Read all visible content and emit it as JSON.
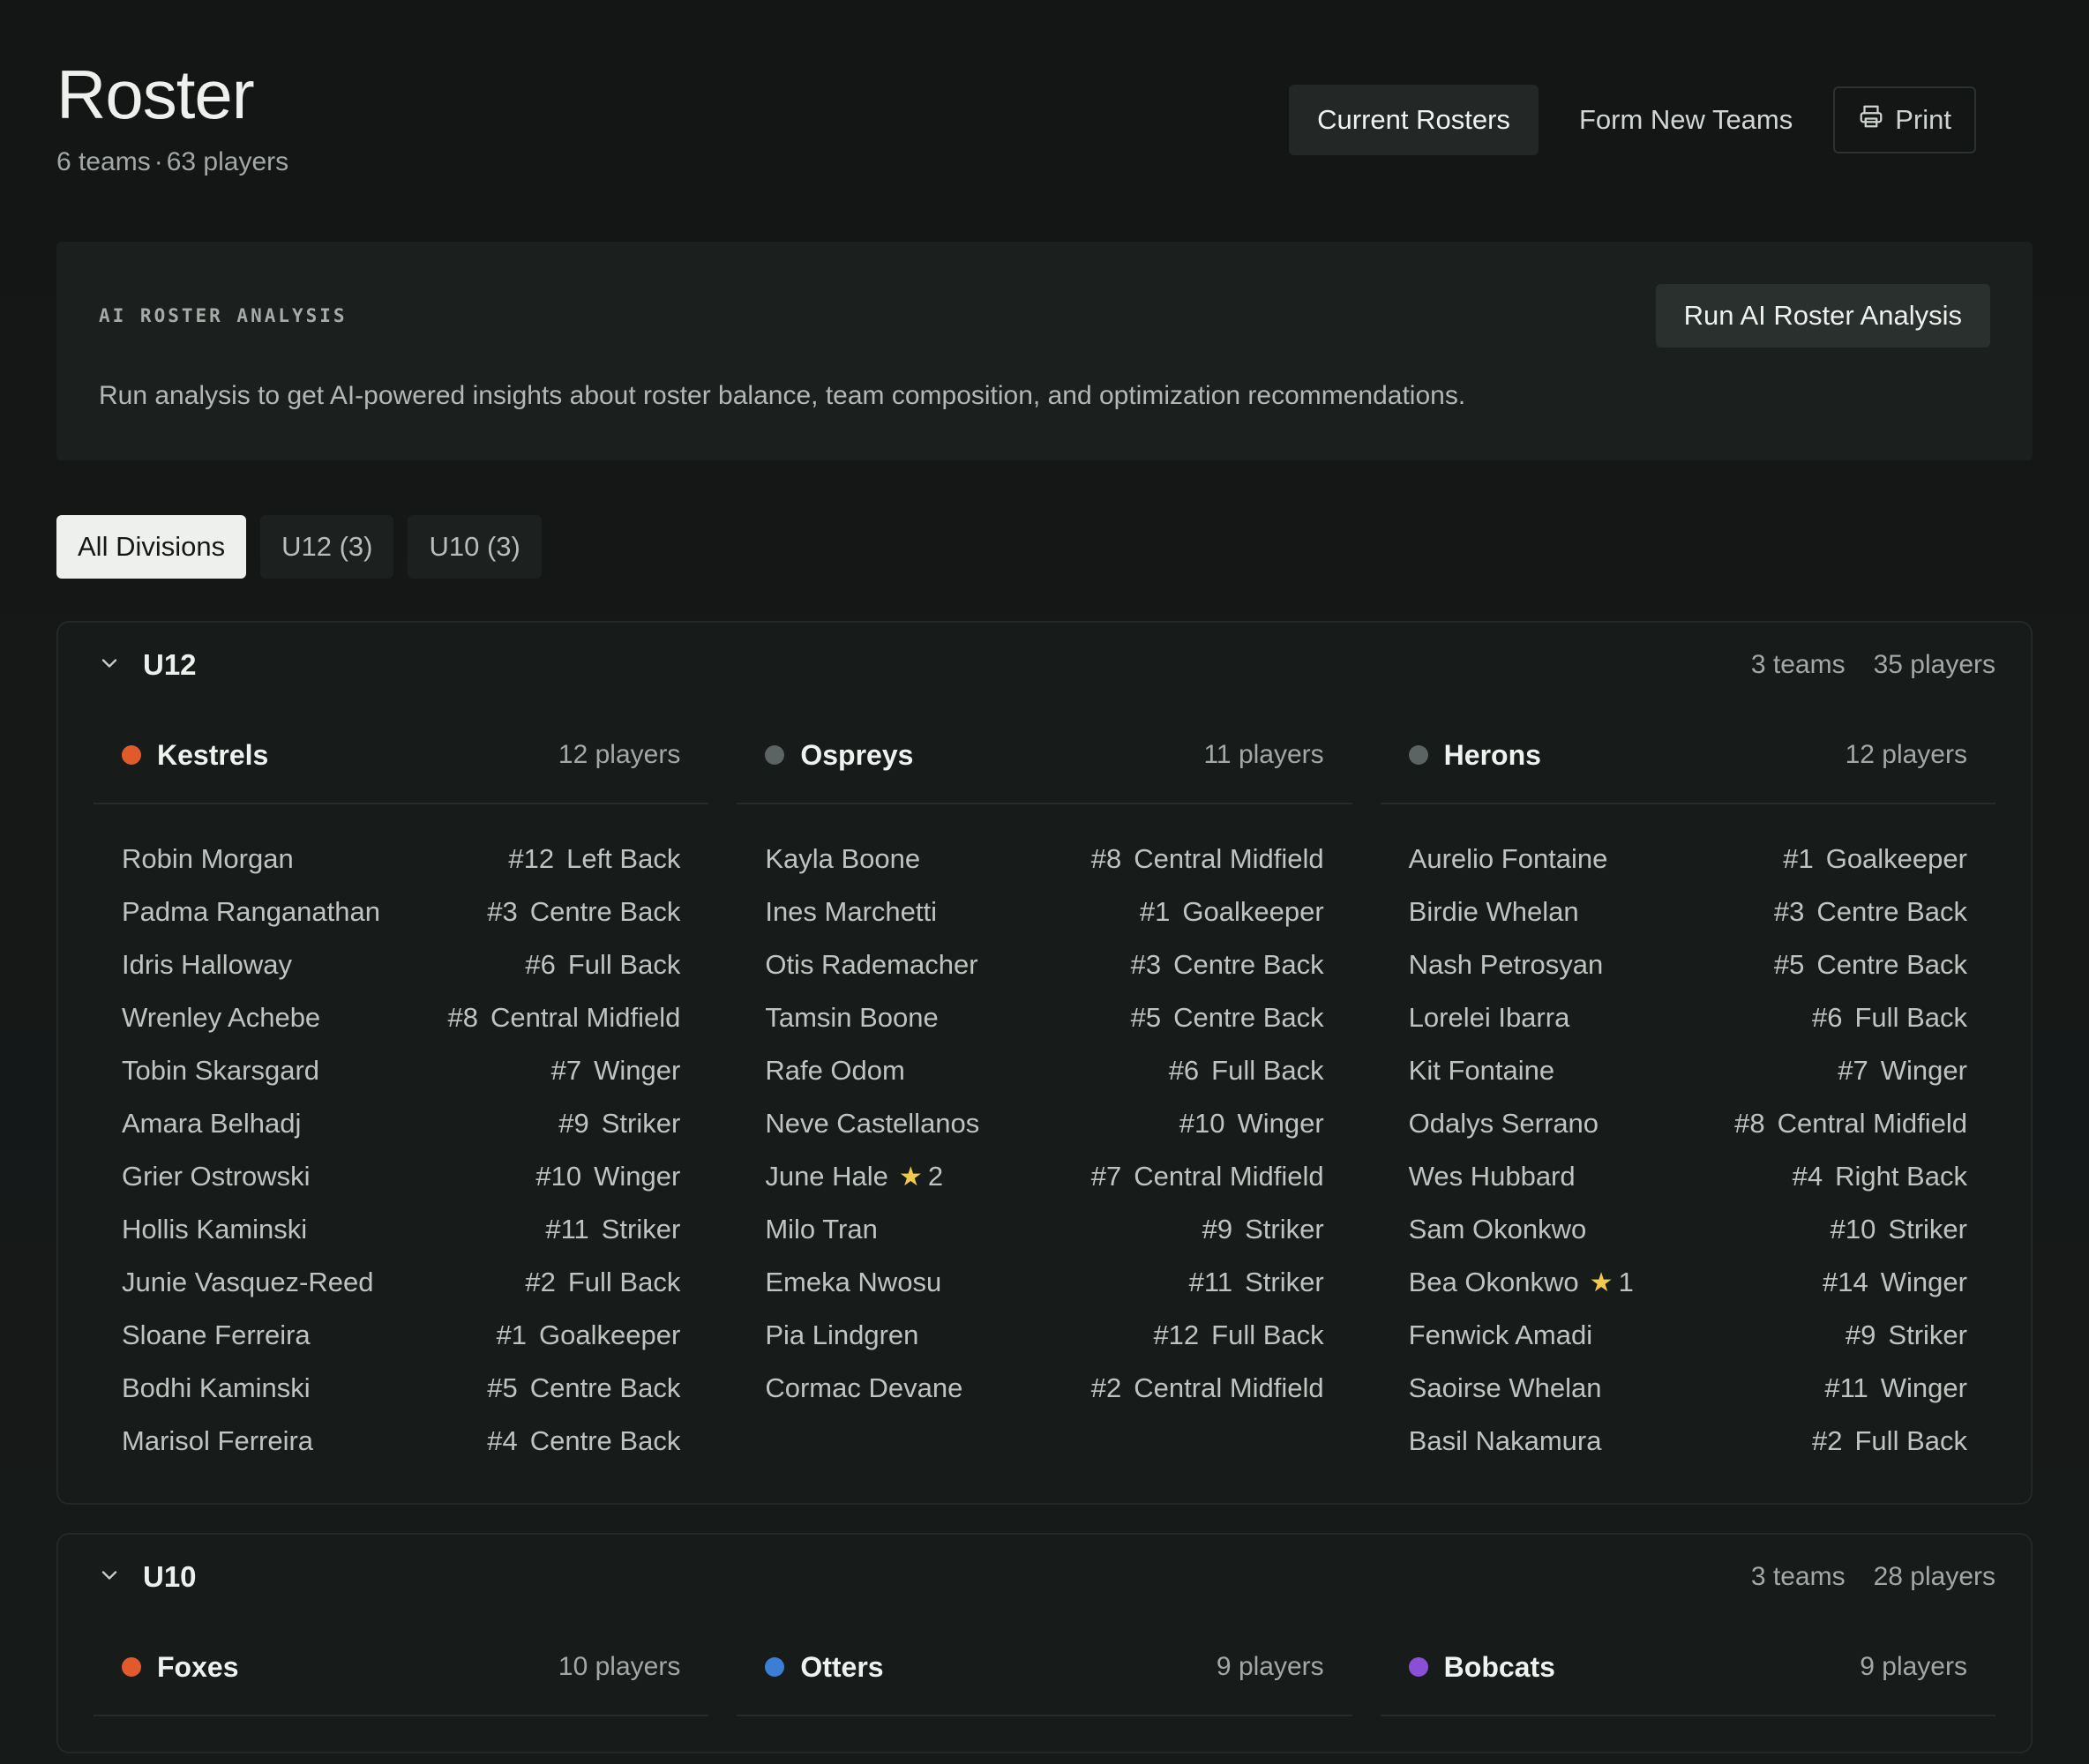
{
  "header": {
    "title": "Roster",
    "teams_count": "6 teams",
    "players_count": "63 players",
    "separator": "·",
    "buttons": {
      "current_rosters": "Current Rosters",
      "form_new_teams": "Form New Teams",
      "print": "Print"
    },
    "icons": {
      "print": "printer-icon"
    }
  },
  "ai_panel": {
    "label": "AI ROSTER ANALYSIS",
    "run_button": "Run AI Roster Analysis",
    "description": "Run analysis to get AI-powered insights about roster balance, team composition, and optimization recommendations."
  },
  "filters": [
    {
      "label": "All Divisions",
      "active": true
    },
    {
      "label": "U12 (3)",
      "active": false
    },
    {
      "label": "U10 (3)",
      "active": false
    }
  ],
  "divisions": [
    {
      "name": "U12",
      "teams_label": "3 teams",
      "players_label": "35 players",
      "teams": [
        {
          "name": "Kestrels",
          "color": "#e05a2b",
          "count": "12 players",
          "players": [
            {
              "name": "Robin Morgan",
              "number": "#12",
              "position": "Left Back"
            },
            {
              "name": "Padma Ranganathan",
              "number": "#3",
              "position": "Centre Back"
            },
            {
              "name": "Idris Halloway",
              "number": "#6",
              "position": "Full Back"
            },
            {
              "name": "Wrenley Achebe",
              "number": "#8",
              "position": "Central Midfield"
            },
            {
              "name": "Tobin Skarsgard",
              "number": "#7",
              "position": "Winger"
            },
            {
              "name": "Amara Belhadj",
              "number": "#9",
              "position": "Striker"
            },
            {
              "name": "Grier Ostrowski",
              "number": "#10",
              "position": "Winger"
            },
            {
              "name": "Hollis Kaminski",
              "number": "#11",
              "position": "Striker"
            },
            {
              "name": "Junie Vasquez-Reed",
              "number": "#2",
              "position": "Full Back"
            },
            {
              "name": "Sloane Ferreira",
              "number": "#1",
              "position": "Goalkeeper"
            },
            {
              "name": "Bodhi Kaminski",
              "number": "#5",
              "position": "Centre Back"
            },
            {
              "name": "Marisol Ferreira",
              "number": "#4",
              "position": "Centre Back"
            }
          ]
        },
        {
          "name": "Ospreys",
          "color": "#5b6462",
          "count": "11 players",
          "players": [
            {
              "name": "Kayla Boone",
              "number": "#8",
              "position": "Central Midfield"
            },
            {
              "name": "Ines Marchetti",
              "number": "#1",
              "position": "Goalkeeper"
            },
            {
              "name": "Otis Rademacher",
              "number": "#3",
              "position": "Centre Back"
            },
            {
              "name": "Tamsin Boone",
              "number": "#5",
              "position": "Centre Back"
            },
            {
              "name": "Rafe Odom",
              "number": "#6",
              "position": "Full Back"
            },
            {
              "name": "Neve Castellanos",
              "number": "#10",
              "position": "Winger"
            },
            {
              "name": "June Hale",
              "star": "2",
              "number": "#7",
              "position": "Central Midfield"
            },
            {
              "name": "Milo Tran",
              "number": "#9",
              "position": "Striker"
            },
            {
              "name": "Emeka Nwosu",
              "number": "#11",
              "position": "Striker"
            },
            {
              "name": "Pia Lindgren",
              "number": "#12",
              "position": "Full Back"
            },
            {
              "name": "Cormac Devane",
              "number": "#2",
              "position": "Central Midfield"
            }
          ]
        },
        {
          "name": "Herons",
          "color": "#5b6462",
          "count": "12 players",
          "players": [
            {
              "name": "Aurelio Fontaine",
              "number": "#1",
              "position": "Goalkeeper"
            },
            {
              "name": "Birdie Whelan",
              "number": "#3",
              "position": "Centre Back"
            },
            {
              "name": "Nash Petrosyan",
              "number": "#5",
              "position": "Centre Back"
            },
            {
              "name": "Lorelei Ibarra",
              "number": "#6",
              "position": "Full Back"
            },
            {
              "name": "Kit Fontaine",
              "number": "#7",
              "position": "Winger"
            },
            {
              "name": "Odalys Serrano",
              "number": "#8",
              "position": "Central Midfield"
            },
            {
              "name": "Wes Hubbard",
              "number": "#4",
              "position": "Right Back"
            },
            {
              "name": "Sam Okonkwo",
              "number": "#10",
              "position": "Striker"
            },
            {
              "name": "Bea Okonkwo",
              "star": "1",
              "number": "#14",
              "position": "Winger"
            },
            {
              "name": "Fenwick Amadi",
              "number": "#9",
              "position": "Striker"
            },
            {
              "name": "Saoirse Whelan",
              "number": "#11",
              "position": "Winger"
            },
            {
              "name": "Basil Nakamura",
              "number": "#2",
              "position": "Full Back"
            }
          ]
        }
      ]
    },
    {
      "name": "U10",
      "teams_label": "3 teams",
      "players_label": "28 players",
      "teams": [
        {
          "name": "Foxes",
          "color": "#e05a2b",
          "count": "10 players",
          "players": []
        },
        {
          "name": "Otters",
          "color": "#3b7fd4",
          "count": "9 players",
          "players": []
        },
        {
          "name": "Bobcats",
          "color": "#8a4fd6",
          "count": "9 players",
          "players": []
        }
      ]
    }
  ]
}
